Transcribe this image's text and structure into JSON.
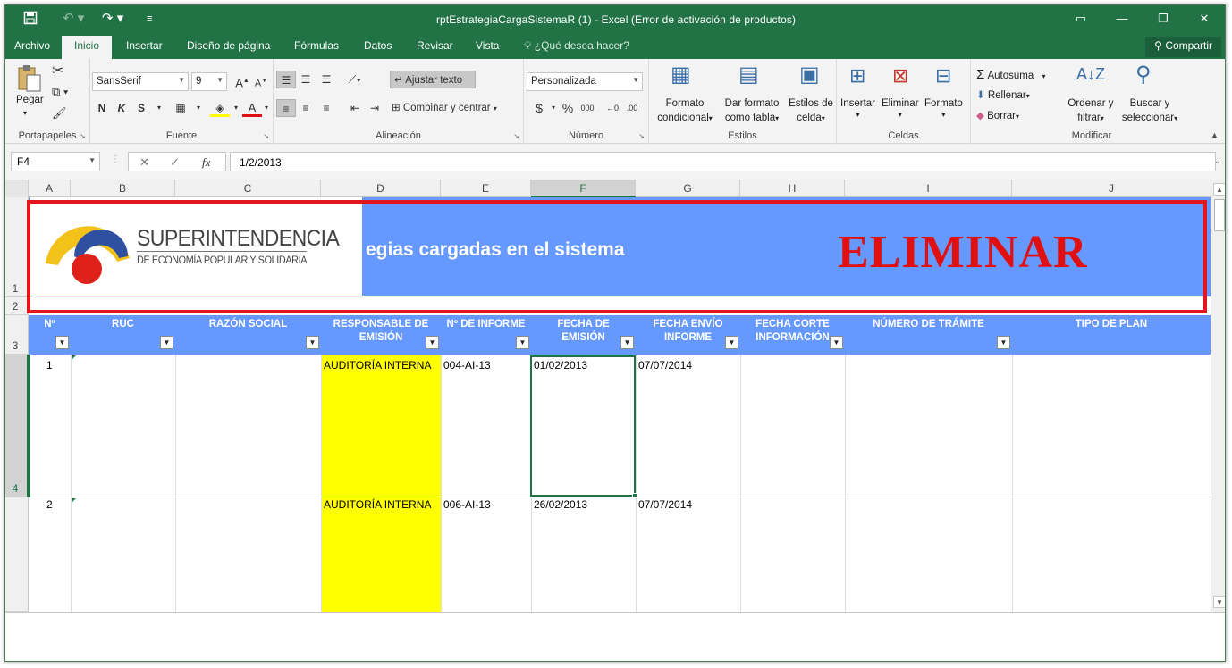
{
  "window": {
    "title": "rptEstrategiaCargaSistemaR (1) - Excel (Error de activación de productos)",
    "save_icon": "save-icon",
    "undo_icon": "undo-icon",
    "redo_icon": "redo-icon"
  },
  "tabs": [
    "Archivo",
    "Inicio",
    "Insertar",
    "Diseño de página",
    "Fórmulas",
    "Datos",
    "Revisar",
    "Vista"
  ],
  "tell_me": "¿Qué desea hacer?",
  "share": "Compartir",
  "ribbon": {
    "clipboard": {
      "paste": "Pegar",
      "label": "Portapapeles"
    },
    "font": {
      "name": "SansSerif",
      "size": "9",
      "bold": "N",
      "italic": "K",
      "underline": "S",
      "label": "Fuente"
    },
    "alignment": {
      "wrap": "Ajustar texto",
      "merge": "Combinar y centrar",
      "label": "Alineación"
    },
    "number": {
      "format": "Personalizada",
      "currency": "$",
      "percent": "%",
      "thousands": "000",
      "label": "Número"
    },
    "styles": {
      "conditional": [
        "Formato",
        "condicional"
      ],
      "table": [
        "Dar formato",
        "como tabla"
      ],
      "cell": [
        "Estilos de",
        "celda"
      ],
      "label": "Estilos"
    },
    "cells": {
      "insert": "Insertar",
      "delete": "Eliminar",
      "format": "Formato",
      "label": "Celdas"
    },
    "editing": {
      "autosum": "Autosuma",
      "fill": "Rellenar",
      "clear": "Borrar",
      "sort": [
        "Ordenar y",
        "filtrar"
      ],
      "find": [
        "Buscar y",
        "seleccionar"
      ],
      "label": "Modificar"
    }
  },
  "formula_bar": {
    "name_box": "F4",
    "fx": "fx",
    "formula": "1/2/2013"
  },
  "columns": [
    "A",
    "B",
    "C",
    "D",
    "E",
    "F",
    "G",
    "H",
    "I",
    "J"
  ],
  "rows": [
    "1",
    "2",
    "3",
    "4"
  ],
  "banner": {
    "logo_line1": "SUPERINTENDENCIA",
    "logo_line2": "DE ECONOMÍA POPULAR Y SOLIDARIA",
    "title_fragment": "egias cargadas en el sistema",
    "stamp": "ELIMINAR"
  },
  "table": {
    "headers": [
      [
        "Nº"
      ],
      [
        "RUC"
      ],
      [
        "RAZÓN SOCIAL"
      ],
      [
        "RESPONSABLE DE",
        "EMISIÓN"
      ],
      [
        "Nº DE INFORME"
      ],
      [
        "FECHA DE",
        "EMISIÓN"
      ],
      [
        "FECHA ENVÍO",
        "INFORME"
      ],
      [
        "FECHA CORTE",
        "INFORMACIÓN"
      ],
      [
        "NÚMERO DE TRÁMITE"
      ],
      [
        "TIPO DE PLAN"
      ]
    ],
    "rows": [
      {
        "n": "1",
        "ruc": "",
        "razon": "",
        "responsable": "AUDITORÍA INTERNA",
        "informe": "004-AI-13",
        "fecha_emision": "01/02/2013",
        "fecha_envio": "07/07/2014"
      },
      {
        "n": "2",
        "ruc": "",
        "razon": "",
        "responsable": "AUDITORÍA INTERNA",
        "informe": "006-AI-13",
        "fecha_emision": "26/02/2013",
        "fecha_envio": "07/07/2014"
      }
    ]
  },
  "colors": {
    "excel_green": "#217346",
    "header_blue": "#6699ff",
    "highlight_yellow": "#ffff00",
    "stamp_red": "#e01010"
  }
}
